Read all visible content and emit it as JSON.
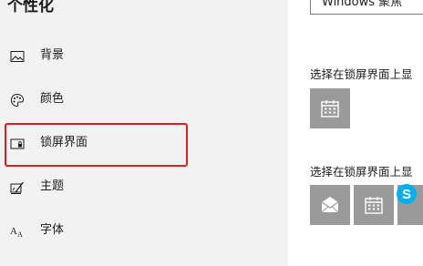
{
  "nav": {
    "title": "个性化",
    "items": [
      {
        "label": "背景",
        "icon": "picture-icon"
      },
      {
        "label": "颜色",
        "icon": "palette-icon"
      },
      {
        "label": "锁屏界面",
        "icon": "lock-screen-icon"
      },
      {
        "label": "主题",
        "icon": "theme-icon"
      },
      {
        "label": "字体",
        "icon": "font-icon"
      }
    ]
  },
  "content": {
    "dropdown_value": "Windows 聚焦",
    "detailed_status_label": "选择在锁屏界面上显",
    "quick_status_label": "选择在锁屏界面上显",
    "detailed_apps": [
      {
        "icon": "calendar-icon"
      }
    ],
    "quick_apps": [
      {
        "icon": "mail-icon"
      },
      {
        "icon": "calendar-icon"
      },
      {
        "icon": "skype-icon"
      }
    ]
  },
  "colors": {
    "highlight": "#e02020",
    "tile_gray": "#9a9a9a",
    "skype_blue": "#00aff0"
  }
}
